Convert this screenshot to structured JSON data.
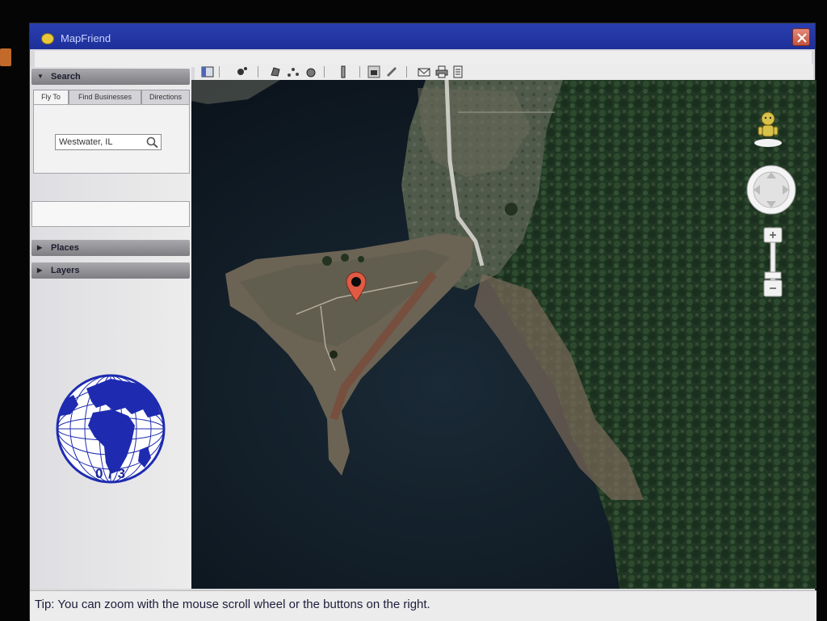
{
  "window": {
    "title": "MapFriend"
  },
  "sidebar": {
    "search_header": "Search",
    "tabs": [
      "Fly To",
      "Find Businesses",
      "Directions"
    ],
    "search_value": "Westwater, IL",
    "places_header": "Places",
    "layers_header": "Layers",
    "globe_counter": "0 / 3"
  },
  "toolbar": {
    "icons": [
      "sidebar-toggle-icon",
      "placemark-icon",
      "polygon-icon",
      "path-icon",
      "overlay-icon",
      "ruler-icon",
      "print-icon",
      "email-icon",
      "printer-icon",
      "document-icon"
    ]
  },
  "map": {
    "pin_color": "#e05a44",
    "control_colors": {
      "pegman": "#d8c24a",
      "nav_ring": "#f2f2f2"
    }
  },
  "status": {
    "tip": "Tip: You can zoom with the mouse scroll wheel or the buttons on the right."
  },
  "colors": {
    "titlebar": "#2238a8",
    "globe": "#1e2bb0",
    "water": "#0f1a24",
    "forest": "#233a26"
  }
}
